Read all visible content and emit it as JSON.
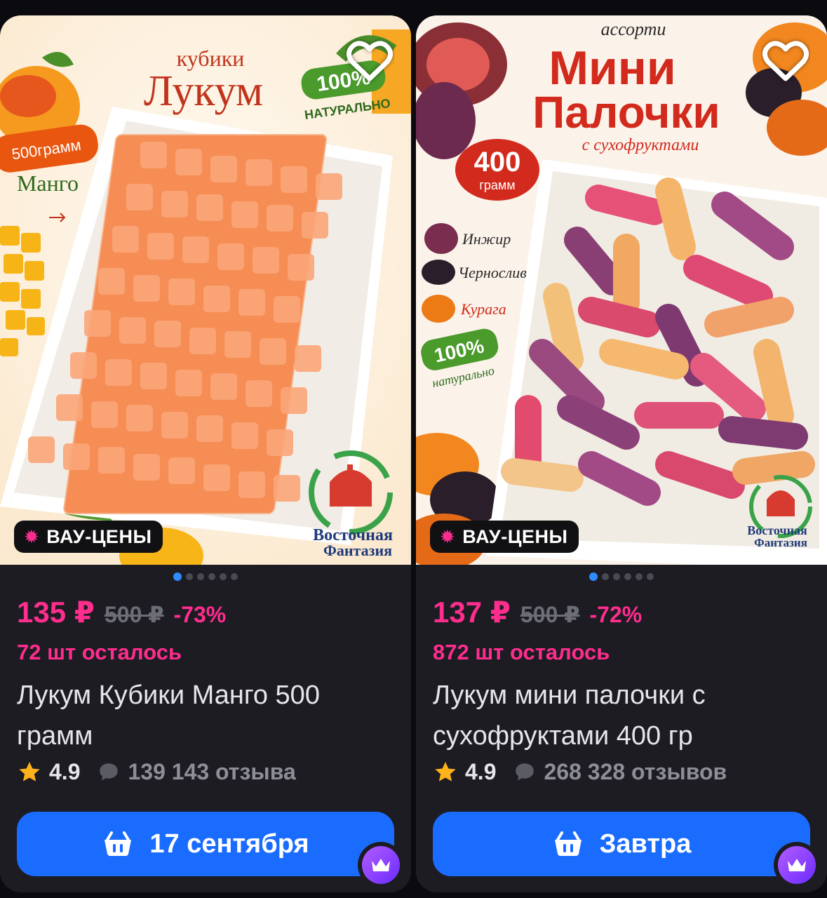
{
  "products": [
    {
      "image": {
        "headline_small": "кубики",
        "headline_big": "Лукум",
        "natural_top": "100%",
        "natural_bottom": "НАТУРАЛЬНО",
        "weight_tag": "500грамм",
        "flavor": "Манго",
        "brand_line1": "Восточная",
        "brand_line2": "Фантазия"
      },
      "badge": "ВАУ-ЦЕНЫ",
      "price": "135 ₽",
      "old_price": "500 ₽",
      "discount": "-73%",
      "stock": "72 шт осталось",
      "title": "Лукум Кубики Манго 500 грамм",
      "rating": "4.9",
      "reviews": "139 143 отзыва",
      "delivery": "17 сентября",
      "gallery_dots": 6
    },
    {
      "image": {
        "headline_small": "ассорти",
        "headline_big1": "Мини",
        "headline_big2": "Палочки",
        "subline": "с сухофруктами",
        "weight_top": "400",
        "weight_bottom": "грамм",
        "fruit1": "Инжир",
        "fruit2": "Чернослив",
        "fruit3": "Курага",
        "natural_top": "100%",
        "natural_bottom": "натурально",
        "brand_line1": "Восточная",
        "brand_line2": "Фантазия"
      },
      "badge": "ВАУ-ЦЕНЫ",
      "price": "137 ₽",
      "old_price": "500 ₽",
      "discount": "-72%",
      "stock": "872 шт осталось",
      "title": "Лукум мини палочки с сухофруктами 400 гр",
      "rating": "4.9",
      "reviews": "268 328 отзывов",
      "delivery": "Завтра",
      "gallery_dots": 6
    }
  ],
  "colors": {
    "accent_pink": "#ff2d8e",
    "cta_blue": "#1a6cff",
    "card_bg": "#1c1c22"
  }
}
